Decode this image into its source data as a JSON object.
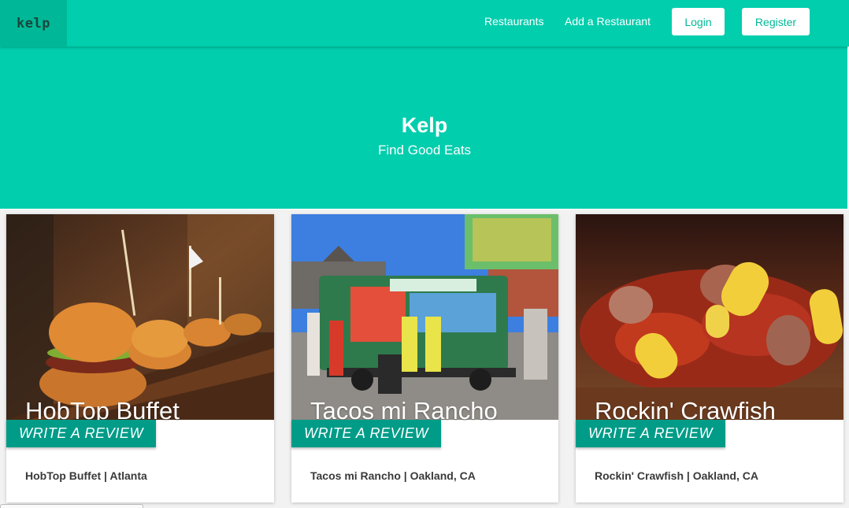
{
  "navbar": {
    "brand": "kelp",
    "links": [
      "Restaurants",
      "Add a Restaurant"
    ],
    "login_label": "Login",
    "register_label": "Register"
  },
  "hero": {
    "title": "Kelp",
    "subtitle": "Find Good Eats"
  },
  "restaurants": [
    {
      "name": "HobTop Buffet",
      "caption": "HobTop Buffet | Atlanta",
      "cta": "WRITE A REVIEW"
    },
    {
      "name": "Tacos mi Rancho",
      "caption": "Tacos mi Rancho | Oakland, CA",
      "cta": "WRITE A REVIEW"
    },
    {
      "name": "Rockin' Crawfish",
      "caption": "Rockin' Crawfish | Oakland, CA",
      "cta": "WRITE A REVIEW"
    }
  ],
  "colors": {
    "primary": "#00cead",
    "brand_bg": "#00b897",
    "cta": "#009c88"
  }
}
